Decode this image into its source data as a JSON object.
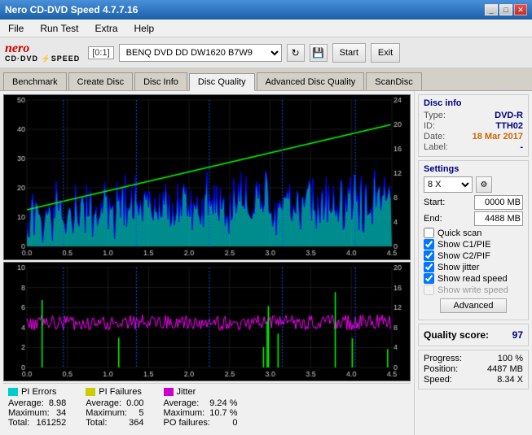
{
  "window": {
    "title": "Nero CD-DVD Speed 4.7.7.16",
    "min_label": "_",
    "max_label": "□",
    "close_label": "✕"
  },
  "menu": {
    "items": [
      "File",
      "Run Test",
      "Extra",
      "Help"
    ]
  },
  "toolbar": {
    "drive_label": "[0:1]",
    "drive_name": "BENQ DVD DD DW1620 B7W9",
    "start_label": "Start",
    "exit_label": "Exit"
  },
  "tabs": [
    {
      "label": "Benchmark",
      "active": false
    },
    {
      "label": "Create Disc",
      "active": false
    },
    {
      "label": "Disc Info",
      "active": false
    },
    {
      "label": "Disc Quality",
      "active": true
    },
    {
      "label": "Advanced Disc Quality",
      "active": false
    },
    {
      "label": "ScanDisc",
      "active": false
    }
  ],
  "disc_info": {
    "title": "Disc info",
    "type_label": "Type:",
    "type_val": "DVD-R",
    "id_label": "ID:",
    "id_val": "TTH02",
    "date_label": "Date:",
    "date_val": "18 Mar 2017",
    "label_label": "Label:",
    "label_val": "-"
  },
  "settings": {
    "title": "Settings",
    "speed_val": "8 X",
    "start_label": "Start:",
    "start_val": "0000 MB",
    "end_label": "End:",
    "end_val": "4488 MB",
    "quick_scan_label": "Quick scan",
    "show_c1pie_label": "Show C1/PIE",
    "show_c2pif_label": "Show C2/PIF",
    "show_jitter_label": "Show jitter",
    "show_read_speed_label": "Show read speed",
    "show_write_speed_label": "Show write speed",
    "advanced_btn": "Advanced"
  },
  "quality": {
    "score_label": "Quality score:",
    "score_val": "97"
  },
  "progress": {
    "progress_label": "Progress:",
    "progress_val": "100 %",
    "position_label": "Position:",
    "position_val": "4487 MB",
    "speed_label": "Speed:",
    "speed_val": "8.34 X"
  },
  "legend": {
    "pi_errors": {
      "title": "PI Errors",
      "color": "#00cccc",
      "avg_label": "Average:",
      "avg_val": "8.98",
      "max_label": "Maximum:",
      "max_val": "34",
      "total_label": "Total:",
      "total_val": "161252"
    },
    "pi_failures": {
      "title": "PI Failures",
      "color": "#cccc00",
      "avg_label": "Average:",
      "avg_val": "0.00",
      "max_label": "Maximum:",
      "max_val": "5",
      "total_label": "Total:",
      "total_val": "364"
    },
    "jitter": {
      "title": "Jitter",
      "color": "#cc00cc",
      "avg_label": "Average:",
      "avg_val": "9.24 %",
      "max_label": "Maximum:",
      "max_val": "10.7 %",
      "po_label": "PO failures:",
      "po_val": "0"
    }
  },
  "colors": {
    "accent": "#000080",
    "background": "#f0f0f0",
    "chart_bg": "#000000"
  }
}
